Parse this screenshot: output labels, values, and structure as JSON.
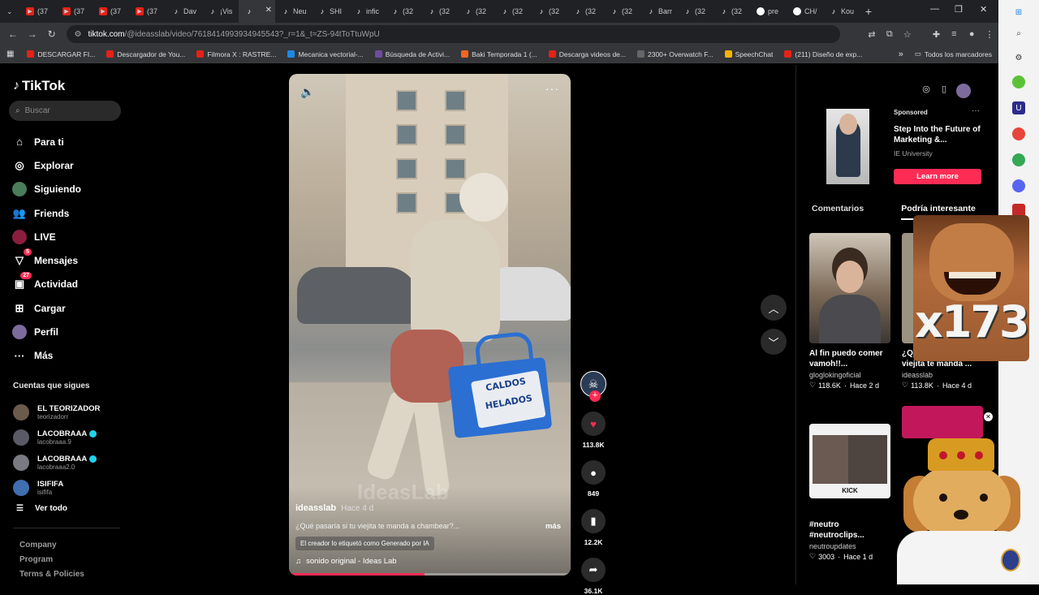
{
  "browser": {
    "tabs": [
      {
        "label": "(37",
        "kind": "yt"
      },
      {
        "label": "(37",
        "kind": "yt"
      },
      {
        "label": "(37",
        "kind": "yt"
      },
      {
        "label": "(37",
        "kind": "yt"
      },
      {
        "label": "Dav",
        "kind": "tt"
      },
      {
        "label": "¡Vis",
        "kind": "tt"
      },
      {
        "label": "",
        "kind": "tt",
        "active": true
      },
      {
        "label": "Neu",
        "kind": "tt"
      },
      {
        "label": "SHI",
        "kind": "tt"
      },
      {
        "label": "infic",
        "kind": "tt"
      },
      {
        "label": "(32",
        "kind": "tt"
      },
      {
        "label": "(32",
        "kind": "tt"
      },
      {
        "label": "(32",
        "kind": "tt"
      },
      {
        "label": "(32",
        "kind": "tt"
      },
      {
        "label": "(32",
        "kind": "tt"
      },
      {
        "label": "(32",
        "kind": "tt"
      },
      {
        "label": "(32",
        "kind": "tt"
      },
      {
        "label": "Barr",
        "kind": "tt"
      },
      {
        "label": "(32",
        "kind": "tt"
      },
      {
        "label": "(32",
        "kind": "tt"
      },
      {
        "label": "pre",
        "kind": "g"
      },
      {
        "label": "CH/",
        "kind": "g"
      },
      {
        "label": "Kou",
        "kind": "tt"
      }
    ],
    "url_host": "tiktok.com",
    "url_rest": "/@ideasslab/video/7618414993934945543?_r=1&_t=ZS-94tToTtuWpU",
    "bookmarks": [
      {
        "label": "DESCARGAR FI...",
        "color": "#e62117"
      },
      {
        "label": "Descargador de You...",
        "color": "#e62117"
      },
      {
        "label": "Filmora X : RASTRE...",
        "color": "#e62117"
      },
      {
        "label": "Mecanica vectorial-...",
        "color": "#1e88e5"
      },
      {
        "label": "Búsqueda de Activi...",
        "color": "#6d4c9f"
      },
      {
        "label": "Baki Temporada 1 (...",
        "color": "#f26522"
      },
      {
        "label": "Descarga videos de...",
        "color": "#e62117"
      },
      {
        "label": "2300+ Overwatch F...",
        "color": "#666666"
      },
      {
        "label": "SpeechChat",
        "color": "#f4b400"
      },
      {
        "label": "(211) Diseño de exp...",
        "color": "#e62117"
      }
    ],
    "all_bookmarks": "Todos los marcadores"
  },
  "tiktok": {
    "logo": "TikTok",
    "search_placeholder": "Buscar",
    "nav": [
      {
        "label": "Para ti",
        "icon": "home-icon"
      },
      {
        "label": "Explorar",
        "icon": "compass-icon"
      },
      {
        "label": "Siguiendo",
        "icon": "following-avatar-icon"
      },
      {
        "label": "Friends",
        "icon": "friends-icon"
      },
      {
        "label": "LIVE",
        "icon": "live-icon"
      },
      {
        "label": "Mensajes",
        "icon": "messages-icon",
        "badge": "5"
      },
      {
        "label": "Actividad",
        "icon": "activity-icon",
        "badge": "27"
      },
      {
        "label": "Cargar",
        "icon": "upload-icon"
      },
      {
        "label": "Perfil",
        "icon": "profile-icon"
      },
      {
        "label": "Más",
        "icon": "more-icon"
      }
    ],
    "following_title": "Cuentas que sigues",
    "following": [
      {
        "name": "EL TEORIZADOR",
        "user": "teorizadorr",
        "verified": false
      },
      {
        "name": "LACOBRAAA",
        "user": "lacobraaa.9",
        "verified": true
      },
      {
        "name": "LACOBRAAA",
        "user": "lacobraaa2.0",
        "verified": true
      },
      {
        "name": "ISIFIFA",
        "user": "isififa",
        "verified": false
      }
    ],
    "see_all": "Ver todo",
    "footer": [
      "Company",
      "Program",
      "Terms & Policies"
    ]
  },
  "video": {
    "watermark": "IdeasLab",
    "cooler_text": "CALDOS HELADOS",
    "author": "ideasslab",
    "ago": "Hace 4 d",
    "caption": "¿Qué pasaría si tu viejita te manda a chambear?...",
    "more": "más",
    "ai_label": "El creador lo etiquetó como Generado por IA",
    "sound": "sonido original - Ideas Lab",
    "progress": 0.48,
    "likes": "113.8K",
    "comments": "849",
    "saves": "12.2K",
    "shares": "36.1K"
  },
  "ad": {
    "sponsored": "Sponsored",
    "title": "Step Into the Future of Marketing &...",
    "advertiser": "IE University",
    "cta": "Learn more"
  },
  "right_tabs": {
    "comments": "Comentarios",
    "interesting": "Podría interesante"
  },
  "cards": [
    {
      "title": "Al fin puedo comer vamoh!!...",
      "user": "gloglokingoficial",
      "likes": "118.6K",
      "ago": "Hace 2 d"
    },
    {
      "title": "¿Qué pasaría si tu viejita te manda ...",
      "user": "ideasslab",
      "likes": "113.8K",
      "ago": "Hace 4 d"
    },
    {
      "title": "#neutro #neutroclips...",
      "user": "neutroupdates",
      "likes": "3003",
      "ago": "Hace 1 d",
      "thumb_text": "KICK"
    }
  ],
  "overlay": {
    "text": "x173"
  }
}
